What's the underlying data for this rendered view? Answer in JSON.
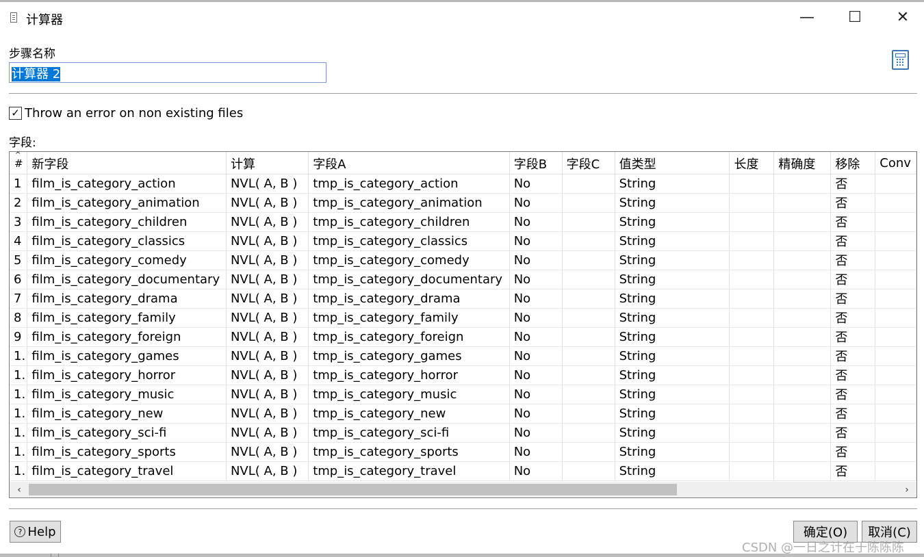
{
  "window": {
    "title": "计算器",
    "minimize_glyph": "—",
    "maximize_glyph": "☐",
    "close_glyph": "✕"
  },
  "step_name": {
    "label": "步骤名称",
    "value": "计算器 2"
  },
  "checkbox": {
    "label": "Throw an error on non existing files",
    "checked": true,
    "glyph": "✓"
  },
  "fields": {
    "label": "字段:",
    "columns": [
      "#",
      "新字段",
      "计算",
      "字段A",
      "字段B",
      "字段C",
      "值类型",
      "长度",
      "精确度",
      "移除",
      "Conv"
    ],
    "rows": [
      [
        "1",
        "film_is_category_action",
        "NVL( A, B )",
        "tmp_is_category_action",
        "No",
        "",
        "String",
        "",
        "",
        "否",
        ""
      ],
      [
        "2",
        "film_is_category_animation",
        "NVL( A, B )",
        "tmp_is_category_animation",
        "No",
        "",
        "String",
        "",
        "",
        "否",
        ""
      ],
      [
        "3",
        "film_is_category_children",
        "NVL( A, B )",
        "tmp_is_category_children",
        "No",
        "",
        "String",
        "",
        "",
        "否",
        ""
      ],
      [
        "4",
        "film_is_category_classics",
        "NVL( A, B )",
        "tmp_is_category_classics",
        "No",
        "",
        "String",
        "",
        "",
        "否",
        ""
      ],
      [
        "5",
        "film_is_category_comedy",
        "NVL( A, B )",
        "tmp_is_category_comedy",
        "No",
        "",
        "String",
        "",
        "",
        "否",
        ""
      ],
      [
        "6",
        "film_is_category_documentary",
        "NVL( A, B )",
        "tmp_is_category_documentary",
        "No",
        "",
        "String",
        "",
        "",
        "否",
        ""
      ],
      [
        "7",
        "film_is_category_drama",
        "NVL( A, B )",
        "tmp_is_category_drama",
        "No",
        "",
        "String",
        "",
        "",
        "否",
        ""
      ],
      [
        "8",
        "film_is_category_family",
        "NVL( A, B )",
        "tmp_is_category_family",
        "No",
        "",
        "String",
        "",
        "",
        "否",
        ""
      ],
      [
        "9",
        "film_is_category_foreign",
        "NVL( A, B )",
        "tmp_is_category_foreign",
        "No",
        "",
        "String",
        "",
        "",
        "否",
        ""
      ],
      [
        "1.",
        "film_is_category_games",
        "NVL( A, B )",
        "tmp_is_category_games",
        "No",
        "",
        "String",
        "",
        "",
        "否",
        ""
      ],
      [
        "1.",
        "film_is_category_horror",
        "NVL( A, B )",
        "tmp_is_category_horror",
        "No",
        "",
        "String",
        "",
        "",
        "否",
        ""
      ],
      [
        "1.",
        "film_is_category_music",
        "NVL( A, B )",
        "tmp_is_category_music",
        "No",
        "",
        "String",
        "",
        "",
        "否",
        ""
      ],
      [
        "1.",
        "film_is_category_new",
        "NVL( A, B )",
        "tmp_is_category_new",
        "No",
        "",
        "String",
        "",
        "",
        "否",
        ""
      ],
      [
        "1.",
        "film_is_category_sci-fi",
        "NVL( A, B )",
        "tmp_is_category_sci-fi",
        "No",
        "",
        "String",
        "",
        "",
        "否",
        ""
      ],
      [
        "1.",
        "film_is_category_sports",
        "NVL( A, B )",
        "tmp_is_category_sports",
        "No",
        "",
        "String",
        "",
        "",
        "否",
        ""
      ],
      [
        "1.",
        "film_is_category_travel",
        "NVL( A, B )",
        "tmp_is_category_travel",
        "No",
        "",
        "String",
        "",
        "",
        "否",
        ""
      ]
    ]
  },
  "scrollbar": {
    "left_glyph": "‹",
    "right_glyph": "›"
  },
  "buttons": {
    "help_icon": "?",
    "help": "Help",
    "ok": "确定(O)",
    "cancel": "取消(C)"
  },
  "watermark": "CSDN @一日之计在于陈陈陈"
}
